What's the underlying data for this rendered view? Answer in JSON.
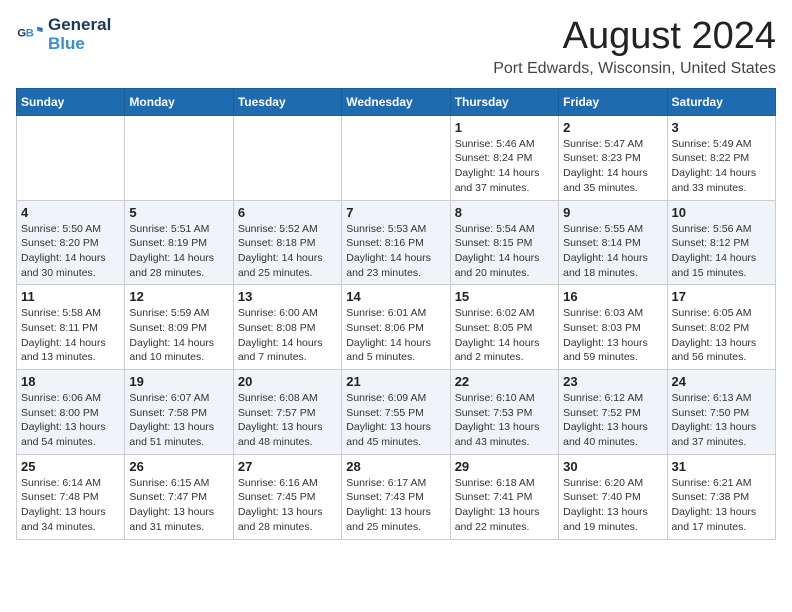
{
  "logo": {
    "name_line1": "General",
    "name_line2": "Blue"
  },
  "title": "August 2024",
  "subtitle": "Port Edwards, Wisconsin, United States",
  "days_of_week": [
    "Sunday",
    "Monday",
    "Tuesday",
    "Wednesday",
    "Thursday",
    "Friday",
    "Saturday"
  ],
  "weeks": [
    [
      {
        "day": "",
        "info": ""
      },
      {
        "day": "",
        "info": ""
      },
      {
        "day": "",
        "info": ""
      },
      {
        "day": "",
        "info": ""
      },
      {
        "day": "1",
        "info": "Sunrise: 5:46 AM\nSunset: 8:24 PM\nDaylight: 14 hours\nand 37 minutes."
      },
      {
        "day": "2",
        "info": "Sunrise: 5:47 AM\nSunset: 8:23 PM\nDaylight: 14 hours\nand 35 minutes."
      },
      {
        "day": "3",
        "info": "Sunrise: 5:49 AM\nSunset: 8:22 PM\nDaylight: 14 hours\nand 33 minutes."
      }
    ],
    [
      {
        "day": "4",
        "info": "Sunrise: 5:50 AM\nSunset: 8:20 PM\nDaylight: 14 hours\nand 30 minutes."
      },
      {
        "day": "5",
        "info": "Sunrise: 5:51 AM\nSunset: 8:19 PM\nDaylight: 14 hours\nand 28 minutes."
      },
      {
        "day": "6",
        "info": "Sunrise: 5:52 AM\nSunset: 8:18 PM\nDaylight: 14 hours\nand 25 minutes."
      },
      {
        "day": "7",
        "info": "Sunrise: 5:53 AM\nSunset: 8:16 PM\nDaylight: 14 hours\nand 23 minutes."
      },
      {
        "day": "8",
        "info": "Sunrise: 5:54 AM\nSunset: 8:15 PM\nDaylight: 14 hours\nand 20 minutes."
      },
      {
        "day": "9",
        "info": "Sunrise: 5:55 AM\nSunset: 8:14 PM\nDaylight: 14 hours\nand 18 minutes."
      },
      {
        "day": "10",
        "info": "Sunrise: 5:56 AM\nSunset: 8:12 PM\nDaylight: 14 hours\nand 15 minutes."
      }
    ],
    [
      {
        "day": "11",
        "info": "Sunrise: 5:58 AM\nSunset: 8:11 PM\nDaylight: 14 hours\nand 13 minutes."
      },
      {
        "day": "12",
        "info": "Sunrise: 5:59 AM\nSunset: 8:09 PM\nDaylight: 14 hours\nand 10 minutes."
      },
      {
        "day": "13",
        "info": "Sunrise: 6:00 AM\nSunset: 8:08 PM\nDaylight: 14 hours\nand 7 minutes."
      },
      {
        "day": "14",
        "info": "Sunrise: 6:01 AM\nSunset: 8:06 PM\nDaylight: 14 hours\nand 5 minutes."
      },
      {
        "day": "15",
        "info": "Sunrise: 6:02 AM\nSunset: 8:05 PM\nDaylight: 14 hours\nand 2 minutes."
      },
      {
        "day": "16",
        "info": "Sunrise: 6:03 AM\nSunset: 8:03 PM\nDaylight: 13 hours\nand 59 minutes."
      },
      {
        "day": "17",
        "info": "Sunrise: 6:05 AM\nSunset: 8:02 PM\nDaylight: 13 hours\nand 56 minutes."
      }
    ],
    [
      {
        "day": "18",
        "info": "Sunrise: 6:06 AM\nSunset: 8:00 PM\nDaylight: 13 hours\nand 54 minutes."
      },
      {
        "day": "19",
        "info": "Sunrise: 6:07 AM\nSunset: 7:58 PM\nDaylight: 13 hours\nand 51 minutes."
      },
      {
        "day": "20",
        "info": "Sunrise: 6:08 AM\nSunset: 7:57 PM\nDaylight: 13 hours\nand 48 minutes."
      },
      {
        "day": "21",
        "info": "Sunrise: 6:09 AM\nSunset: 7:55 PM\nDaylight: 13 hours\nand 45 minutes."
      },
      {
        "day": "22",
        "info": "Sunrise: 6:10 AM\nSunset: 7:53 PM\nDaylight: 13 hours\nand 43 minutes."
      },
      {
        "day": "23",
        "info": "Sunrise: 6:12 AM\nSunset: 7:52 PM\nDaylight: 13 hours\nand 40 minutes."
      },
      {
        "day": "24",
        "info": "Sunrise: 6:13 AM\nSunset: 7:50 PM\nDaylight: 13 hours\nand 37 minutes."
      }
    ],
    [
      {
        "day": "25",
        "info": "Sunrise: 6:14 AM\nSunset: 7:48 PM\nDaylight: 13 hours\nand 34 minutes."
      },
      {
        "day": "26",
        "info": "Sunrise: 6:15 AM\nSunset: 7:47 PM\nDaylight: 13 hours\nand 31 minutes."
      },
      {
        "day": "27",
        "info": "Sunrise: 6:16 AM\nSunset: 7:45 PM\nDaylight: 13 hours\nand 28 minutes."
      },
      {
        "day": "28",
        "info": "Sunrise: 6:17 AM\nSunset: 7:43 PM\nDaylight: 13 hours\nand 25 minutes."
      },
      {
        "day": "29",
        "info": "Sunrise: 6:18 AM\nSunset: 7:41 PM\nDaylight: 13 hours\nand 22 minutes."
      },
      {
        "day": "30",
        "info": "Sunrise: 6:20 AM\nSunset: 7:40 PM\nDaylight: 13 hours\nand 19 minutes."
      },
      {
        "day": "31",
        "info": "Sunrise: 6:21 AM\nSunset: 7:38 PM\nDaylight: 13 hours\nand 17 minutes."
      }
    ]
  ]
}
